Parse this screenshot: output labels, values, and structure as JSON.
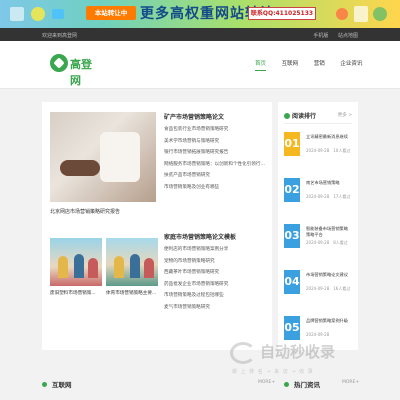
{
  "banner": {
    "tag": "本站转让中",
    "headline": "更多高权重网站转让",
    "contact": "联系QQ:411025133"
  },
  "topbar": {
    "welcome": "欢迎来到高登网",
    "links": [
      "手机版",
      "站点地图"
    ]
  },
  "header": {
    "logo_text": "高登网",
    "nav": [
      {
        "label": "首页",
        "active": true
      },
      {
        "label": "互联网",
        "active": false
      },
      {
        "label": "营销",
        "active": false
      },
      {
        "label": "企业资讯",
        "active": false
      }
    ]
  },
  "main": {
    "featured_caption": "北京网店市场营销策略研究报告",
    "section1_title": "矿产市场营销策略论文",
    "section1_items": [
      "食品包装行业市场营销策略研究",
      "美术学市场营销与策略研究",
      "银行市场营销拓展策略研究报告",
      "网络服务市场营销策略：以创新和个性化引领行业...",
      "扶贫产品市场营销研究",
      "市场营销策略及创业有哪些"
    ],
    "section2_title": "家庭市场营销策略论文模板",
    "section2_items": [
      "便利店的市场营销策略案例分享",
      "宠物的市场营销策略研究",
      "西藏茶叶市场营销策略研究",
      "药品批发企业市场营销策略研究",
      "市场营销策略及过程包括哪些",
      "麦气市场营销策略研究"
    ],
    "thumb_captions": [
      "废旧塑料市场营销策...",
      "体育市场营销策略主要..."
    ]
  },
  "sidebar": {
    "title": "阅读排行",
    "more": "更多 >",
    "items": [
      {
        "num": "01",
        "title": "立讯精密最新消息继续",
        "date": "2024-09-28",
        "views": "10人看过",
        "color": "#f5b820"
      },
      {
        "num": "02",
        "title": "南艺市场营销策略",
        "date": "2024-09-28",
        "views": "17人看过",
        "color": "#3aa0e0"
      },
      {
        "num": "03",
        "title": "智能装备市场营销策略策略平台",
        "date": "2024-09-28",
        "views": "8人看过",
        "color": "#3aa0e0"
      },
      {
        "num": "04",
        "title": "市场营销策略论文建议",
        "date": "2024-09-28",
        "views": "16人看过",
        "color": "#3aa0e0"
      },
      {
        "num": "05",
        "title": "品牌营销策略案例升级",
        "date": "2024-09-28",
        "views": "",
        "color": "#3aa0e0"
      }
    ]
  },
  "bottom": {
    "left_title": "互联网",
    "left_more": "MORE+",
    "right_title": "热门资讯",
    "right_more": "MORE+"
  },
  "watermark": {
    "text": "自动秒收录",
    "sub": "做 上 排 名 → 来 访 → 收 录"
  }
}
